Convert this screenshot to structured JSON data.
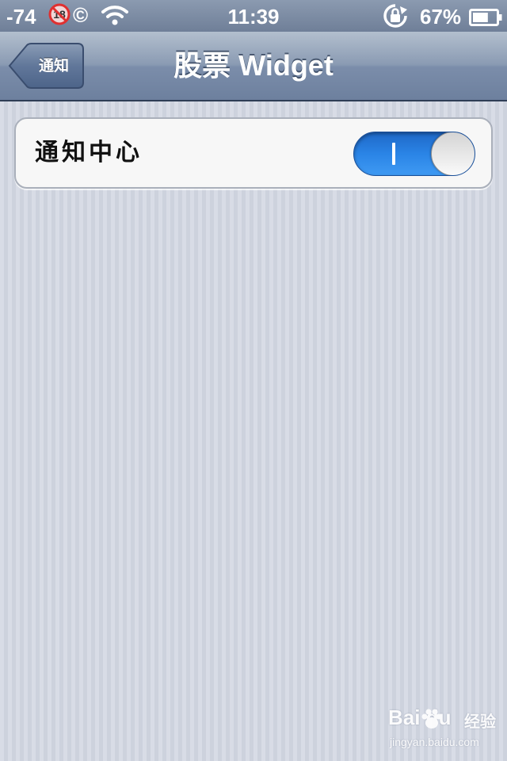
{
  "status_bar": {
    "signal": "-74",
    "restricted_badge": "18",
    "copyright_symbol": "©",
    "time": "11:39",
    "battery_percent": "67%",
    "battery_level": 0.67
  },
  "nav_bar": {
    "back_label": "通知",
    "title": "股票 Widget"
  },
  "settings": {
    "rows": [
      {
        "label": "通知中心",
        "toggle_on": true
      }
    ]
  },
  "watermark": {
    "logo": "Bai du",
    "name": "经验",
    "domain": "jingyan.baidu.com"
  },
  "colors": {
    "accent_toggle": "#2a84e6",
    "nav_bar": "#7b8daa",
    "background": "#d3d8e2"
  }
}
